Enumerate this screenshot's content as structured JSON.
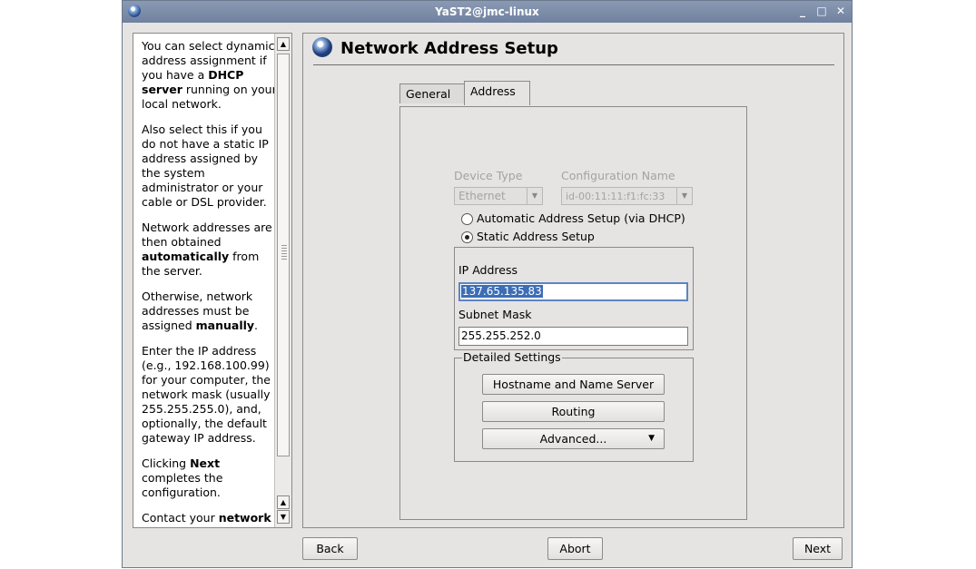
{
  "window": {
    "title": "YaST2@jmc-linux"
  },
  "help": {
    "paragraphs": [
      [
        "You can select dynamic address assignment if you have a ",
        {
          "b": "DHCP server"
        },
        " running on your local network."
      ],
      [
        "Also select this if you do not have a static IP address assigned by the system administrator or your cable or DSL provider."
      ],
      [
        "Network addresses are then obtained ",
        {
          "b": "automatically"
        },
        " from the server."
      ],
      [
        "Otherwise, network addresses must be assigned ",
        {
          "b": "manually"
        },
        "."
      ],
      [
        "Enter the IP address (e.g., 192.168.100.99) for your computer, the network mask (usually 255.255.255.0), and, optionally, the default gateway IP address."
      ],
      [
        "Clicking ",
        {
          "b": "Next"
        },
        " completes the configuration."
      ],
      [
        "Contact your ",
        {
          "b": "network"
        }
      ]
    ]
  },
  "page": {
    "title": "Network Address Setup"
  },
  "tabs": {
    "general": "General",
    "address": "Address"
  },
  "device": {
    "device_type_label": "Device Type",
    "device_type_value": "Ethernet",
    "config_name_label": "Configuration Name",
    "config_name_value": "id-00:11:11:f1:fc:33"
  },
  "radios": {
    "dhcp": "Automatic Address Setup (via DHCP)",
    "static": "Static Address Setup",
    "selected": "static"
  },
  "static": {
    "ip_label": "IP Address",
    "ip_value": "137.65.135.83",
    "mask_label": "Subnet Mask",
    "mask_value": "255.255.252.0"
  },
  "detailed": {
    "title": "Detailed Settings",
    "hostname_button": "Hostname and Name Server",
    "routing_button": "Routing",
    "advanced_button": "Advanced..."
  },
  "footer": {
    "back": "Back",
    "abort": "Abort",
    "next": "Next"
  }
}
